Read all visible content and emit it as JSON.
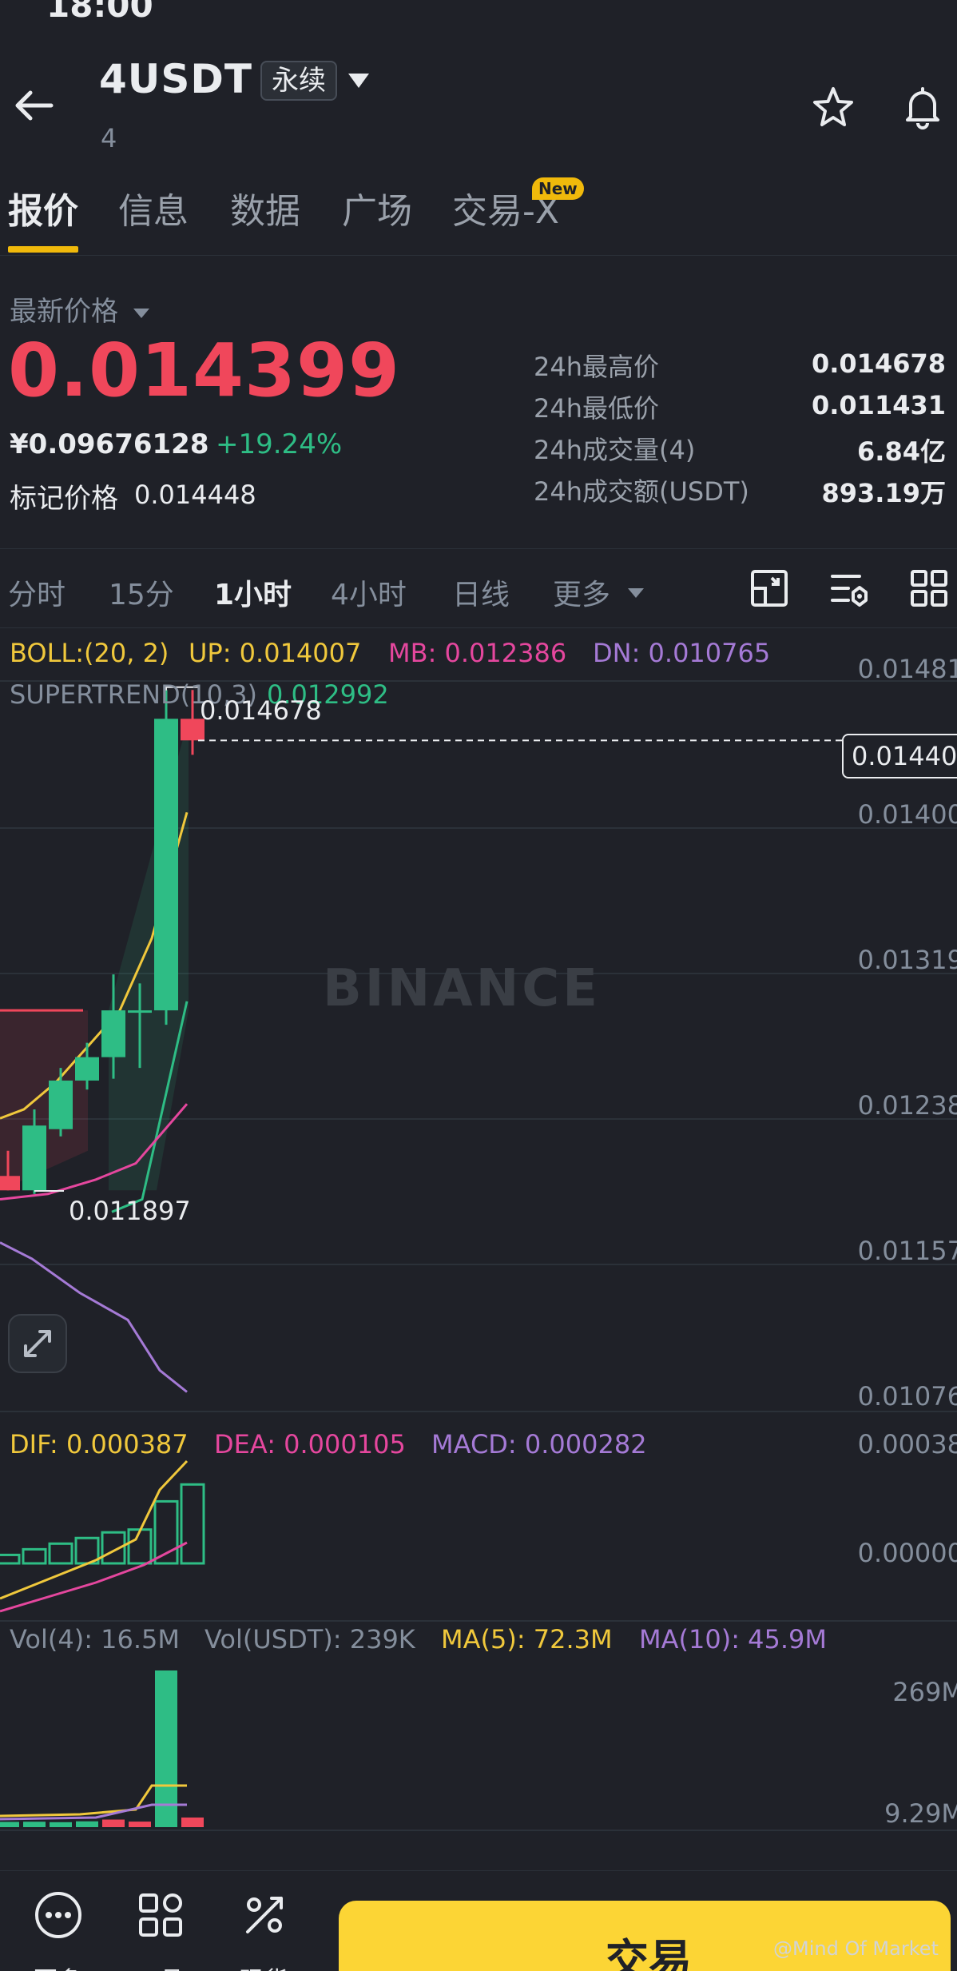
{
  "status_bar": {
    "time": "18:00"
  },
  "header": {
    "symbol": "4USDT",
    "contract_type": "永续",
    "subtitle": "4"
  },
  "tabs": [
    {
      "label": "报价"
    },
    {
      "label": "信息"
    },
    {
      "label": "数据"
    },
    {
      "label": "广场"
    },
    {
      "label": "交易-X"
    }
  ],
  "new_badge": "New",
  "price": {
    "label": "最新价格",
    "last": "0.014399",
    "fiat": "¥0.09676128",
    "change": "+19.24%",
    "mark_label": "标记价格",
    "mark_value": "0.014448"
  },
  "stats": [
    {
      "label": "24h最高价",
      "value": "0.014678"
    },
    {
      "label": "24h最低价",
      "value": "0.011431"
    },
    {
      "label": "24h成交量(4)",
      "value": "6.84亿"
    },
    {
      "label": "24h成交额(USDT)",
      "value": "893.19万"
    }
  ],
  "intervals": [
    {
      "label": "分时"
    },
    {
      "label": "15分"
    },
    {
      "label": "1小时"
    },
    {
      "label": "4小时"
    },
    {
      "label": "日线"
    },
    {
      "label": "更多"
    }
  ],
  "indicators": {
    "boll": "BOLL:(20, 2)",
    "up": "UP: 0.014007",
    "mb": "MB: 0.012386",
    "dn": "DN: 0.010765",
    "supertrend_label": "SUPERTREND(10,3)",
    "supertrend_value": "0.012992",
    "dif": "DIF: 0.000387",
    "dea": "DEA: 0.000105",
    "macd": "MACD: 0.000282",
    "vol": "Vol(4): 16.5M",
    "vol_usdt": "Vol(USDT): 239K",
    "ma5": "MA(5): 72.3M",
    "ma10": "MA(10): 45.9M"
  },
  "price_axis": [
    "0.01481",
    "0.01400",
    "0.01319",
    "0.01238",
    "0.01157",
    "0.01076"
  ],
  "current_price_tag": "0.01440",
  "high_marker": "0.014678",
  "low_marker": "0.011897",
  "macd_axis": [
    "0.00038",
    "0.00000"
  ],
  "vol_axis": [
    "269M",
    "9.29M"
  ],
  "watermark": "BINANCE",
  "bottom_nav": [
    {
      "label": "更多",
      "icon": "more-icon"
    },
    {
      "label": "工具",
      "icon": "tools-icon"
    },
    {
      "label": "现货",
      "icon": "spot-icon"
    }
  ],
  "trade_button": "交易",
  "credit": "@Mind Of Market",
  "colors": {
    "up": "#2ebd85",
    "down": "#f0475b",
    "accent": "#f0b90b",
    "ma_yellow": "#f0c83c",
    "ma_pink": "#e5479e",
    "ma_purple": "#a57ad6"
  },
  "chart_data": [
    {
      "type": "candlestick",
      "title": "",
      "ylim": [
        0.01076,
        0.01481
      ],
      "candles": [
        {
          "open": 0.01198,
          "high": 0.01212,
          "low": 0.0119,
          "close": 0.0119
        },
        {
          "open": 0.0119,
          "high": 0.01235,
          "low": 0.01188,
          "close": 0.01226
        },
        {
          "open": 0.01224,
          "high": 0.01258,
          "low": 0.0122,
          "close": 0.01251
        },
        {
          "open": 0.01251,
          "high": 0.01272,
          "low": 0.01246,
          "close": 0.01264
        },
        {
          "open": 0.01264,
          "high": 0.0131,
          "low": 0.01252,
          "close": 0.0129
        },
        {
          "open": 0.0129,
          "high": 0.01305,
          "low": 0.01258,
          "close": 0.0129
        },
        {
          "open": 0.0129,
          "high": 0.01468,
          "low": 0.01282,
          "close": 0.01452
        },
        {
          "open": 0.01452,
          "high": 0.01468,
          "low": 0.01432,
          "close": 0.0144
        }
      ],
      "high_marker": 0.014678,
      "low_marker": 0.011897,
      "current_price": 0.0144
    },
    {
      "type": "bar",
      "title": "",
      "ylim": [
        0,
        0.00038
      ],
      "values": [
        3e-05,
        5e-05,
        7e-05,
        9e-05,
        0.00011,
        0.00012,
        0.00022,
        0.00028
      ]
    },
    {
      "type": "bar",
      "title": "",
      "ylim": [
        0,
        269
      ],
      "values": [
        9.0,
        9.29,
        8.5,
        10,
        13,
        9.5,
        269,
        16.5
      ]
    }
  ]
}
